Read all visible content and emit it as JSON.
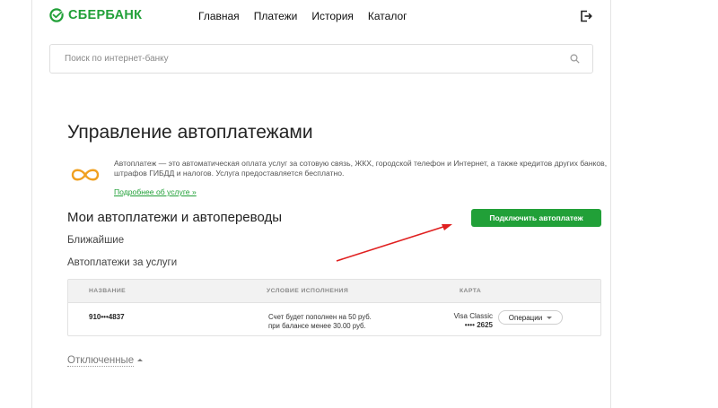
{
  "header": {
    "logo_text": "СБЕРБАНК",
    "logo_icon": "sber-logo-icon",
    "nav": [
      {
        "label": "Главная"
      },
      {
        "label": "Платежи"
      },
      {
        "label": "История"
      },
      {
        "label": "Каталог"
      }
    ],
    "logout_icon": "logout-icon"
  },
  "search": {
    "placeholder": "Поиск по интернет-банку",
    "value": "",
    "icon": "search-icon"
  },
  "page": {
    "title": "Управление автоплатежами"
  },
  "promo": {
    "icon": "infinity-icon",
    "text": "Автоплатеж — это автоматическая оплата услуг за сотовую связь, ЖКХ, городской телефон и Интернет, а также кредитов других банков, штрафов ГИБДД и налогов. Услуга предоставляется бесплатно.",
    "link": "Подробнее об услуге »"
  },
  "section": {
    "title": "Мои автоплатежи и автопереводы",
    "connect_button": "Подключить автоплатеж",
    "nearest_label": "Ближайшие",
    "services_label": "Автоплатежи за услуги"
  },
  "table": {
    "columns": [
      "НАЗВАНИЕ",
      "УСЛОВИЕ ИСПОЛНЕНИЯ",
      "КАРТА"
    ],
    "rows": [
      {
        "name": "910•••4837",
        "condition_line1": "Счет будет пополнен на 50 руб.",
        "condition_line2": "при балансе менее 30.00 руб.",
        "card_name": "Visa Classic",
        "card_number": "•••• 2625",
        "operations_label": "Операции"
      }
    ]
  },
  "disabled_section": {
    "label": "Отключенные"
  },
  "colors": {
    "brand_green": "#21a038",
    "annotation_red": "#e02020",
    "promo_icon_orange": "#f0a020"
  }
}
